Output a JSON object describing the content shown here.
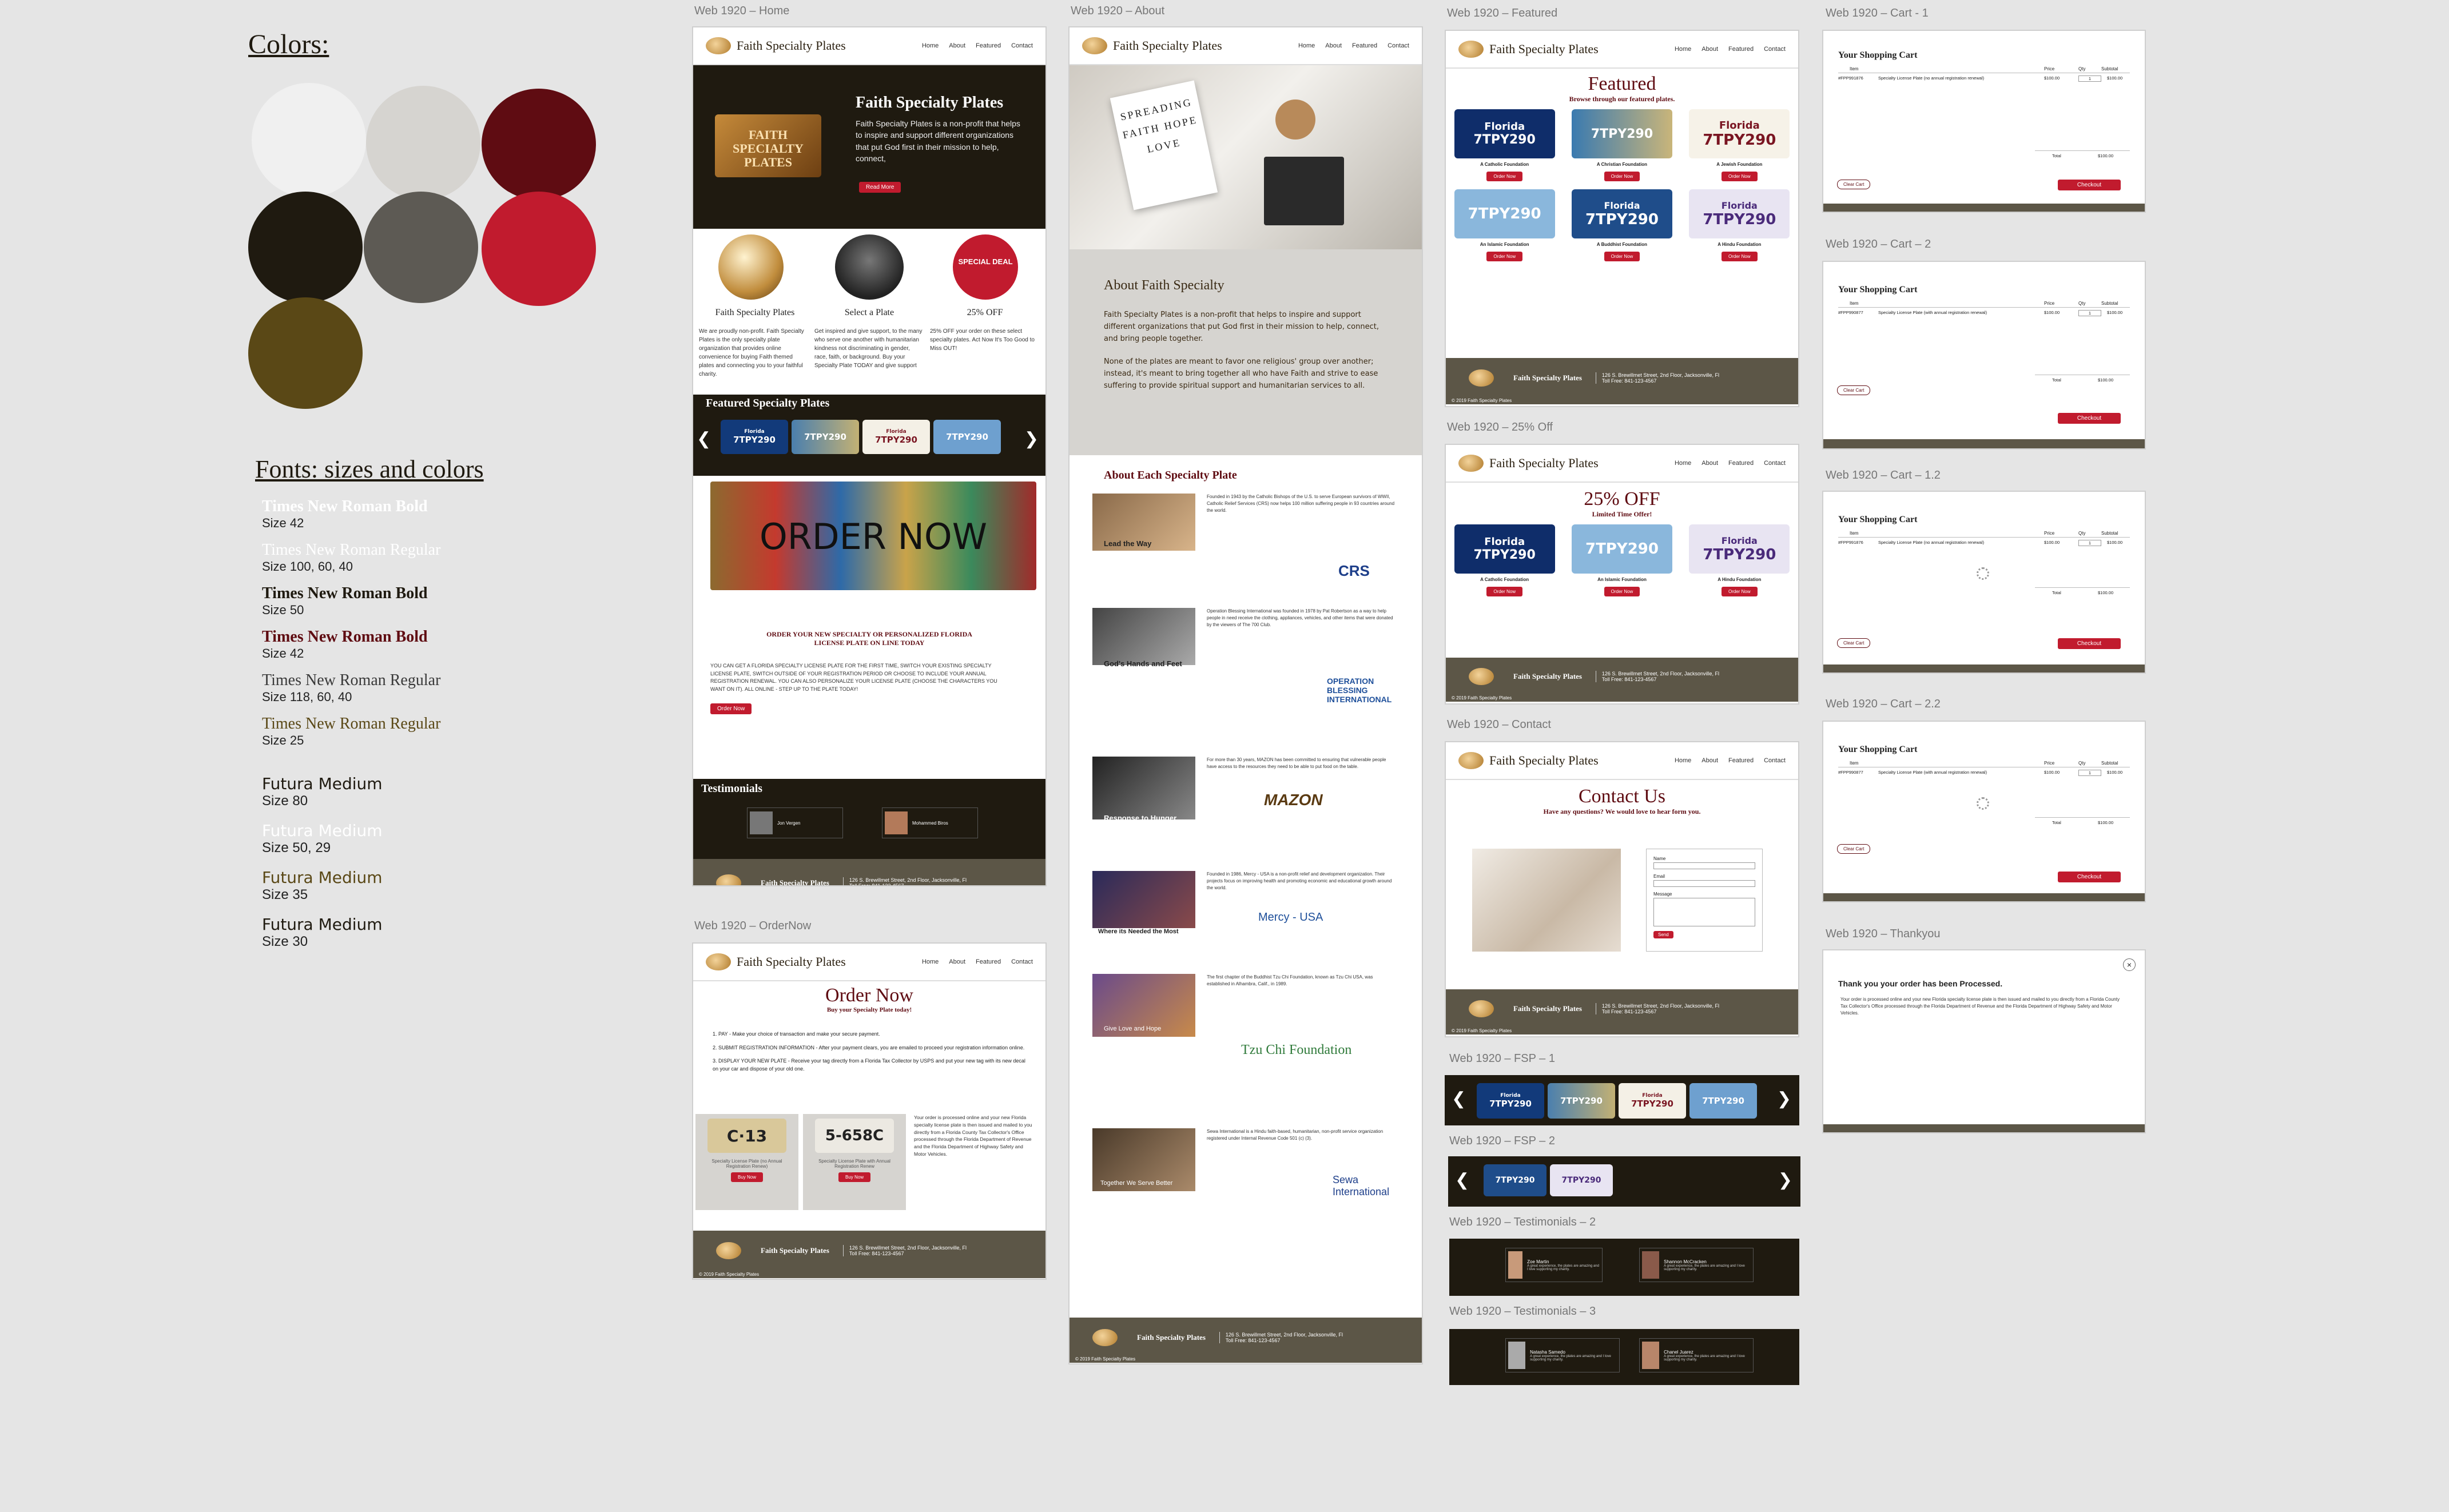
{
  "styleguide": {
    "colors_title": "Colors:",
    "swatches": [
      "#f0f0f0",
      "#d6d4d0",
      "#5f0c12",
      "#1f1a10",
      "#5d5a54",
      "#c11b2e",
      "#5a4816"
    ],
    "fonts_title": "Fonts: sizes and colors",
    "fonts": [
      {
        "name": "Times New Roman Bold",
        "size": "Size 42",
        "color": "#ffffff"
      },
      {
        "name": "Times New Roman Regular",
        "size": "Size 100, 60, 40",
        "color": "#ffffff"
      },
      {
        "name": "Times New Roman Bold",
        "size": "Size 50",
        "color": "#1f1a10"
      },
      {
        "name": "Times New Roman Bold",
        "size": "Size 42",
        "color": "#5f0c12"
      },
      {
        "name": "Times New Roman Regular",
        "size": "Size 118, 60, 40",
        "color": "#3a3a3a"
      },
      {
        "name": "Times New Roman Regular",
        "size": "Size 25",
        "color": "#5a4816"
      },
      {
        "name": "Futura Medium",
        "size": "Size 80",
        "color": "#1f1a10"
      },
      {
        "name": "Futura Medium",
        "size": "Size 50, 29",
        "color": "#ffffff"
      },
      {
        "name": "Futura Medium",
        "size": "Size 35",
        "color": "#5a4816"
      },
      {
        "name": "Futura Medium",
        "size": "Size 30",
        "color": "#1f1a10"
      }
    ]
  },
  "labels": {
    "home": "Web 1920 – Home",
    "about": "Web 1920 – About",
    "featured": "Web 1920 – Featured",
    "cart1": "Web 1920 – Cart - 1",
    "cart2": "Web 1920 – Cart – 2",
    "cart12": "Web 1920 – Cart – 1.2",
    "cart22": "Web 1920 – Cart – 2.2",
    "off25": "Web 1920 – 25% Off",
    "contact": "Web 1920 – Contact",
    "ordernow": "Web 1920 – OrderNow",
    "fsp1": "Web 1920 – FSP – 1",
    "fsp2": "Web 1920 – FSP – 2",
    "test2": "Web 1920 – Testimonials – 2",
    "test3": "Web 1920 – Testimonials – 3",
    "thankyou": "Web 1920 – Thankyou"
  },
  "site": {
    "brand": "Faith Specialty Plates",
    "nav": [
      "Home",
      "About",
      "Featured",
      "Contact"
    ],
    "order_btn": "Order Now",
    "footer_addr": "126 S. Brewillmet Street, 2nd Floor, Jacksonville, Fl",
    "footer_phone": "Toll Free: 841-123-4567",
    "copyright": "© 2019 Faith Specialty Plates"
  },
  "home": {
    "hero_title": "Faith Specialty Plates",
    "hero_text": "Faith Specialty Plates is a non-profit that helps to inspire and support different organizations that put God first in their mission to help, connect,",
    "hero_btn": "Read More",
    "hero_plate": "FAITH SPECIALTY PLATES",
    "col1_title": "Faith Specialty Plates",
    "col2_title": "Select a Plate",
    "col3_title": "25% OFF",
    "special": "SPECIAL DEAL",
    "col1_text": "We are proudly non-profit. Faith Specialty Plates is the only specialty plate organization that provides online convenience for buying Faith themed plates and connecting you to your faithful charity.",
    "col2_text": "Get inspired and give support, to the many who serve one another with humanitarian kindness not discriminating in gender, race, faith, or background. Buy your Specialty Plate TODAY and give support",
    "col3_text": "25% OFF your order on these select specialty plates. Act Now It's Too Good to Miss OUT!",
    "featured_title": "Featured Specialty Plates",
    "order_now_big": "ORDER NOW",
    "order_heading": "ORDER YOUR NEW SPECIALTY OR PERSONALIZED FLORIDA LICENSE PLATE ON LINE TODAY",
    "order_text": "YOU CAN GET A FLORIDA SPECIALTY LICENSE PLATE FOR THE FIRST TIME, SWITCH YOUR EXISTING SPECIALTY LICENSE PLATE, SWITCH OUTSIDE OF YOUR REGISTRATION PERIOD OR CHOOSE TO INCLUDE YOUR ANNUAL REGISTRATION RENEWAL. YOU CAN ALSO PERSONALIZE YOUR LICENSE PLATE (CHOOSE THE CHARACTERS YOU WANT ON IT). ALL ONLINE - STEP UP TO THE PLATE TODAY!",
    "testimonials": "Testimonials"
  },
  "plates": [
    "7TPY290",
    "7TPY290",
    "7TPY290",
    "7TPY290",
    "7TPY290",
    "7TPY290"
  ],
  "plate_states": [
    "Florida",
    "Florida",
    "Florida",
    "Florida",
    "Florida",
    "Florida"
  ],
  "about": {
    "hero_words": "SPREADING FAITH HOPE LOVE",
    "title": "About Faith Specialty",
    "p1": "Faith Specialty Plates is a non-profit that helps to inspire and support different organizations that put God first in their mission to help, connect, and bring people together.",
    "p2": "None of the plates are meant to favor one religious' group over another; instead, it's meant to bring together all who have Faith and strive to ease suffering to provide spiritual support and humanitarian services to all.",
    "section_title": "About Each Specialty Plate",
    "orgs": [
      {
        "img": "Lead the Way",
        "logo": "CRS",
        "text": "Founded in 1943 by the Catholic Bishops of the U.S. to serve European survivors of WWII, Catholic Relief Services (CRS) now helps 100 million suffering people in 93 countries around the world."
      },
      {
        "img": "God's Hands and Feet",
        "logo": "OPERATION BLESSING INTERNATIONAL",
        "text": "Operation Blessing International was founded in 1978 by Pat Robertson as a way to help people in need receive the clothing, appliances, vehicles, and other items that were donated by the viewers of The 700 Club."
      },
      {
        "img": "Response to Hunger",
        "logo": "MAZON",
        "text": "For more than 30 years, MAZON has been committed to ensuring that vulnerable people have access to the resources they need to be able to put food on the table."
      },
      {
        "img": "Where its Needed the Most",
        "logo": "Mercy - USA",
        "text": "Founded in 1986, Mercy - USA is a non-profit relief and development organization. Their projects focus on improving health and promoting economic and educational growth around the world."
      },
      {
        "img": "Give Love and Hope",
        "logo": "Tzu Chi Foundation",
        "text": "The first chapter of the Buddhist Tzu Chi Foundation, known as Tzu Chi USA, was established in Alhambra, Calif., in 1989."
      },
      {
        "img": "Together We Serve Better",
        "logo": "Sewa International",
        "text": "Sewa International is a Hindu faith-based, humanitarian, non-profit service organization registered under Internal Revenue Code 501 (c) (3)."
      }
    ]
  },
  "featured": {
    "title": "Featured",
    "subtitle": "Browse through our featured plates.",
    "captions": [
      "A Catholic Foundation",
      "A Christian Foundation",
      "A Jewish Foundation",
      "An Islamic Foundation",
      "A Buddhist Foundation",
      "A Hindu Foundation"
    ]
  },
  "off25": {
    "title": "25% OFF",
    "subtitle": "Limited Time Offer!",
    "captions": [
      "A Catholic Foundation",
      "An Islamic Foundation",
      "A Hindu Foundation"
    ]
  },
  "contact": {
    "title": "Contact Us",
    "subtitle": "Have any questions? We would love to hear form you.",
    "fields": [
      "Name",
      "Email",
      "Message"
    ],
    "send": "Send"
  },
  "ordernow": {
    "title": "Order Now",
    "subtitle": "Buy your Specialty Plate today!",
    "steps": [
      "1. PAY - Make your choice of transaction and make your secure payment.",
      "2. SUBMIT REGISTRATION INFORMATION - After your payment clears, you are emailed to proceed your registration information online.",
      "3. DISPLAY YOUR NEW PLATE - Receive your tag directly from a Florida Tax Collector by USPS and put your new tag with its new decal on your car and dispose of your old one."
    ],
    "plate1": "C·13",
    "plate2": "5-658C",
    "cap1": "Specialty License Plate (no Annual Registration Renew)",
    "cap2": "Specialty License Plate with Annual Registration Renew",
    "buy": "Buy Now",
    "side_text": "Your order is processed online and your new Florida specialty license plate is then issued and mailed to you directly from a Florida County Tax Collector's Office processed through the Florida Department of Revenue and the Florida Department of Highway Safety and Motor Vehicles."
  },
  "cart": {
    "title": "Your Shopping Cart",
    "headers": [
      "Item",
      "Price",
      "Qty",
      "Subtotal"
    ],
    "row_id1": "#FPP991876",
    "row_id2": "#FPP990877",
    "row_desc1": "Specialty License Plate (no annual registration renewal)",
    "row_desc2": "Specialty License Plate (with annual registration renewal)",
    "price": "$100.00",
    "qty": "1",
    "total_label": "Total",
    "total": "$100.00",
    "clear": "Clear Cart",
    "checkout": "Checkout"
  },
  "thankyou": {
    "title": "Thank you your order has been Processed.",
    "text": "Your order is processed online and your new Florida specialty license plate is then issued and mailed to you directly from a Florida County Tax Collector's Office processed through the Florida Department of Revenue and the Florida Department of Highway Safety and Motor Vehicles."
  },
  "testimonials": {
    "names": [
      "Jon Vergen",
      "Mohammed Biros",
      "Zoe Martin",
      "Shannon McCracken",
      "Natasha Samedo",
      "Chanel Juarez"
    ],
    "quote": "A great experience, the plates are amazing and I love supporting my charity."
  }
}
